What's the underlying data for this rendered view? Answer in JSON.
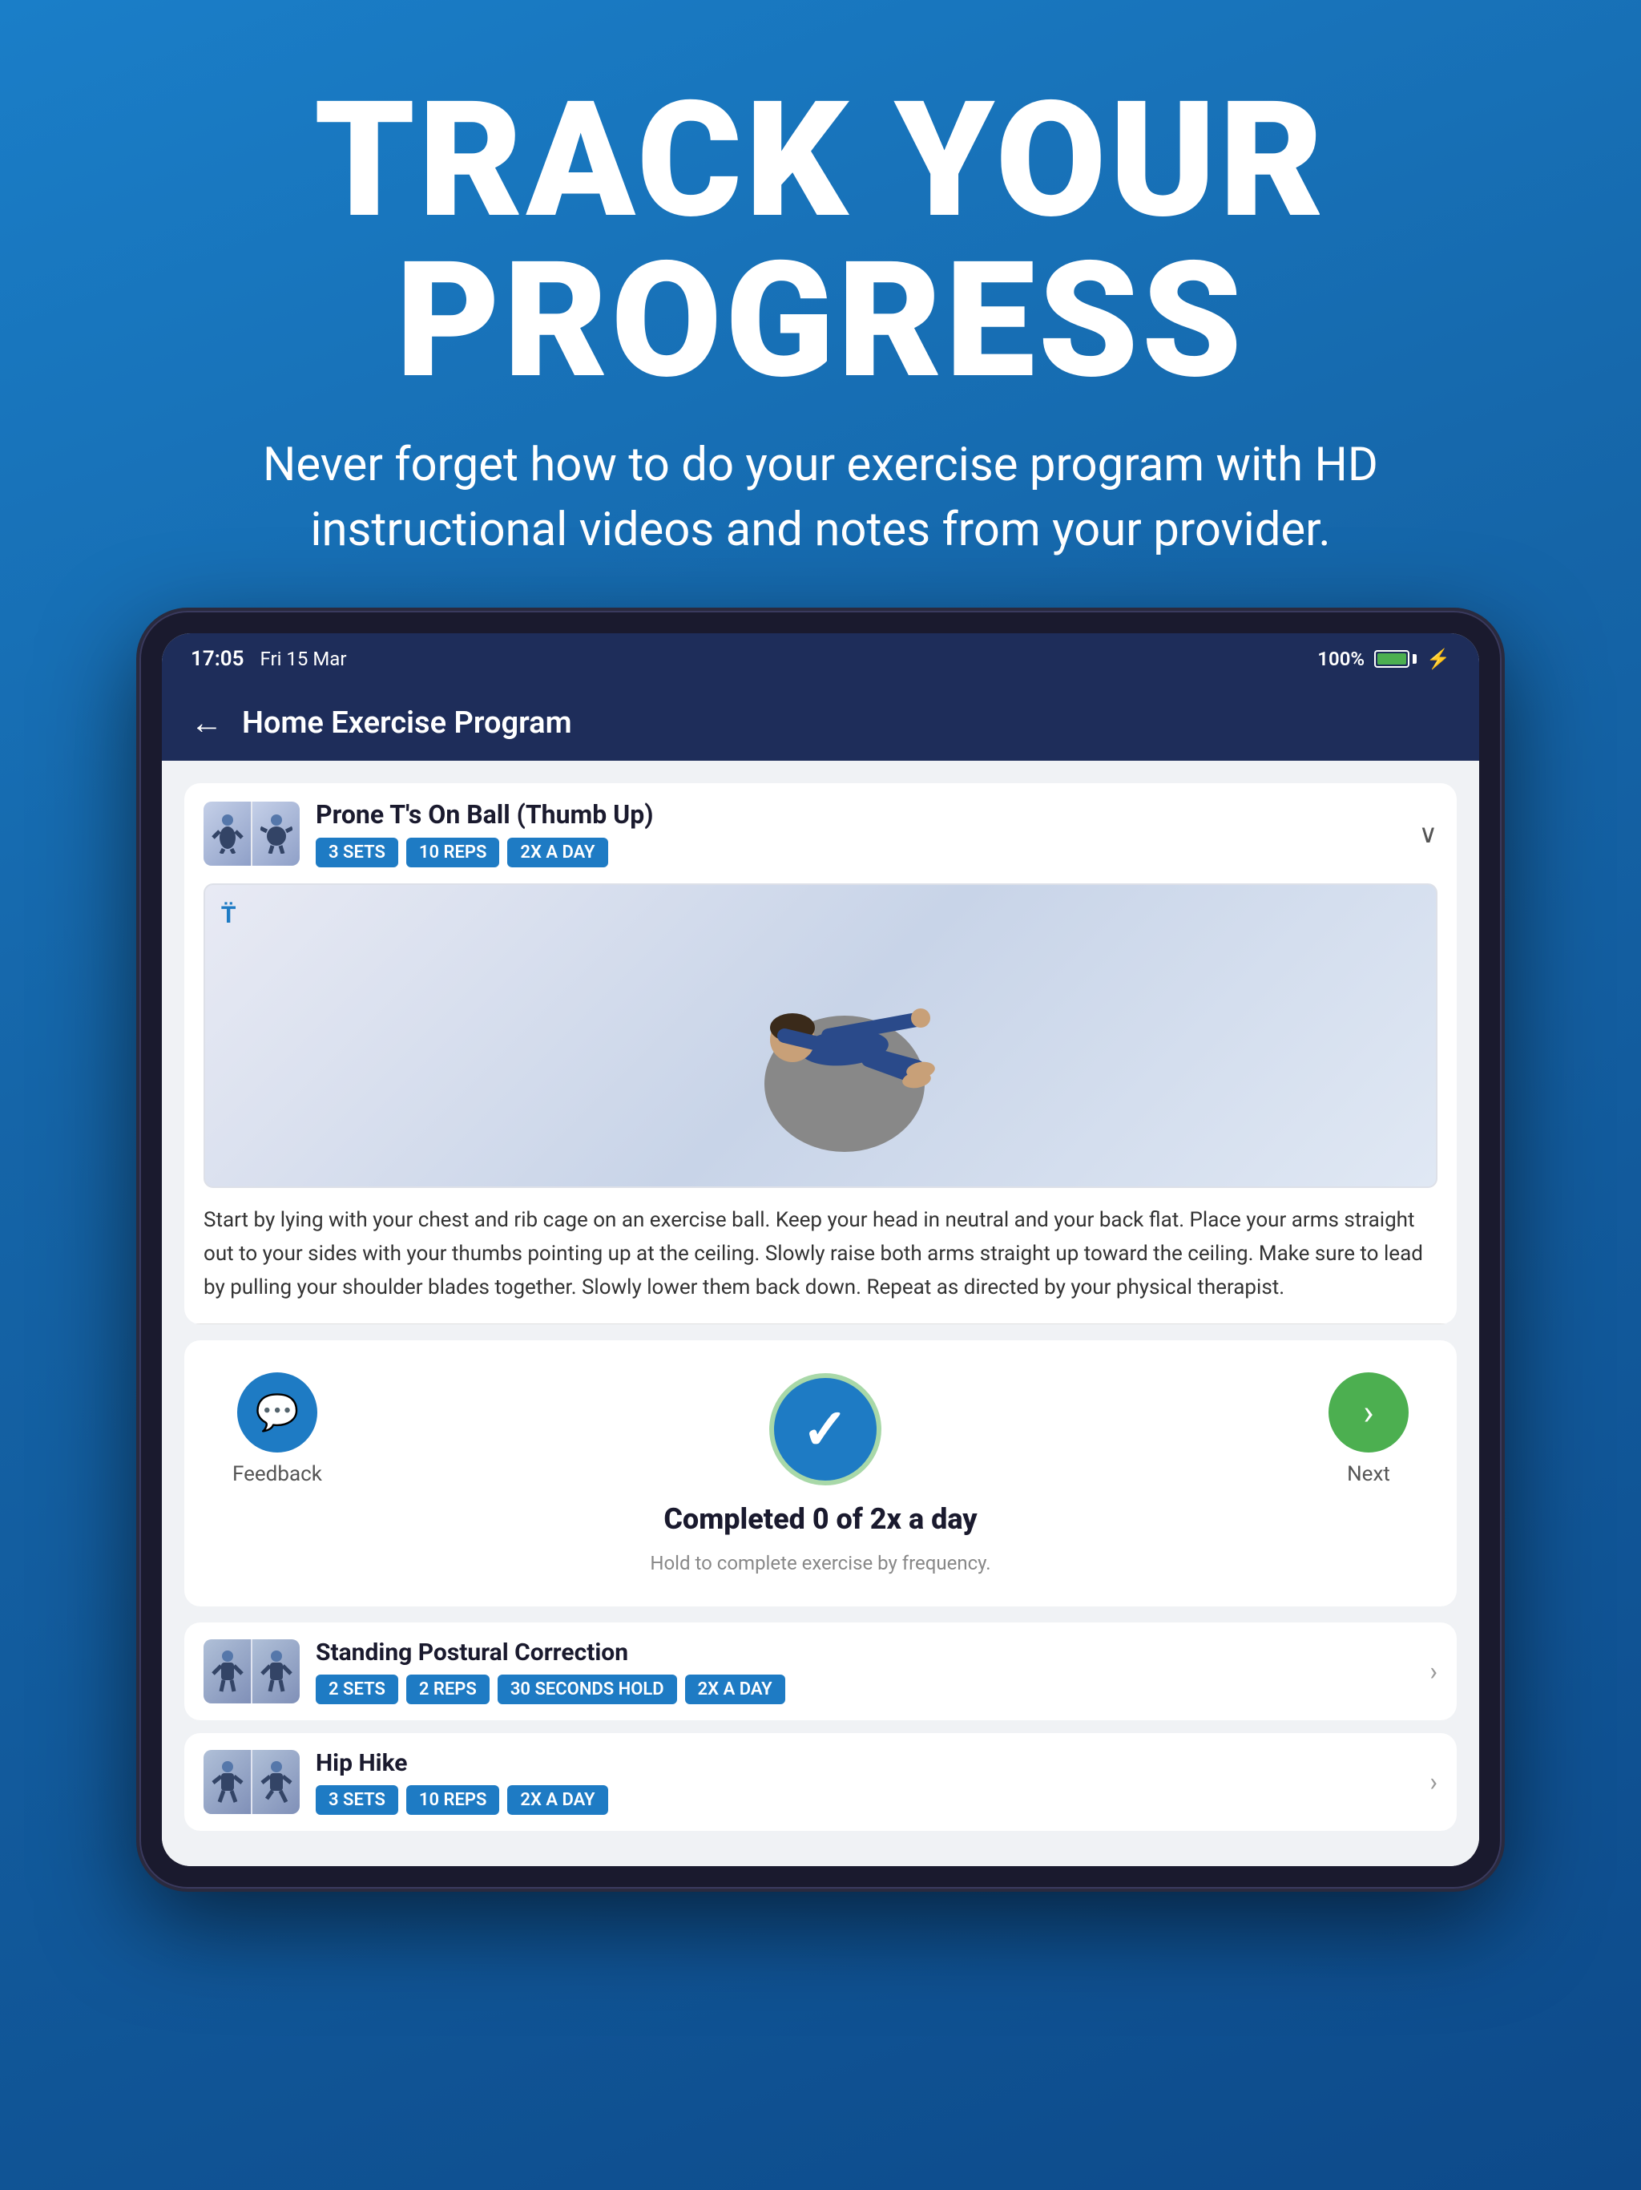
{
  "page": {
    "background_gradient_start": "#1a7ec8",
    "background_gradient_end": "#0d4a8a"
  },
  "header": {
    "title": "TRACK YOUR PROGRESS",
    "subtitle": "Never forget how to do your exercise program with HD instructional videos and notes from your provider."
  },
  "status_bar": {
    "time": "17:05",
    "date": "Fri 15 Mar",
    "battery_percent": "100%"
  },
  "app_header": {
    "back_label": "←",
    "title": "Home Exercise Program"
  },
  "current_exercise": {
    "name": "Prone T's On Ball (Thumb Up)",
    "tags": [
      "3 SETS",
      "10 REPS",
      "2X A DAY"
    ],
    "description": "Start by lying with your chest and rib cage on an exercise ball. Keep your head in neutral and your back flat. Place your arms straight out to your sides with your thumbs pointing up at the ceiling. Slowly raise both arms straight up toward the ceiling. Make sure to lead by pulling your shoulder blades together. Slowly lower them back down. Repeat as directed by your physical therapist.",
    "video_watermark": "T̈"
  },
  "actions": {
    "feedback_label": "Feedback",
    "next_label": "Next",
    "completed_text": "Completed 0 of 2x a day",
    "hold_text": "Hold to complete exercise by frequency."
  },
  "exercise_list": [
    {
      "name": "Standing Postural Correction",
      "tags": [
        "2 SETS",
        "2 REPS",
        "30 SECONDS HOLD",
        "2X A DAY"
      ]
    },
    {
      "name": "Hip Hike",
      "tags": [
        "3 SETS",
        "10 REPS",
        "2X A DAY"
      ]
    }
  ]
}
